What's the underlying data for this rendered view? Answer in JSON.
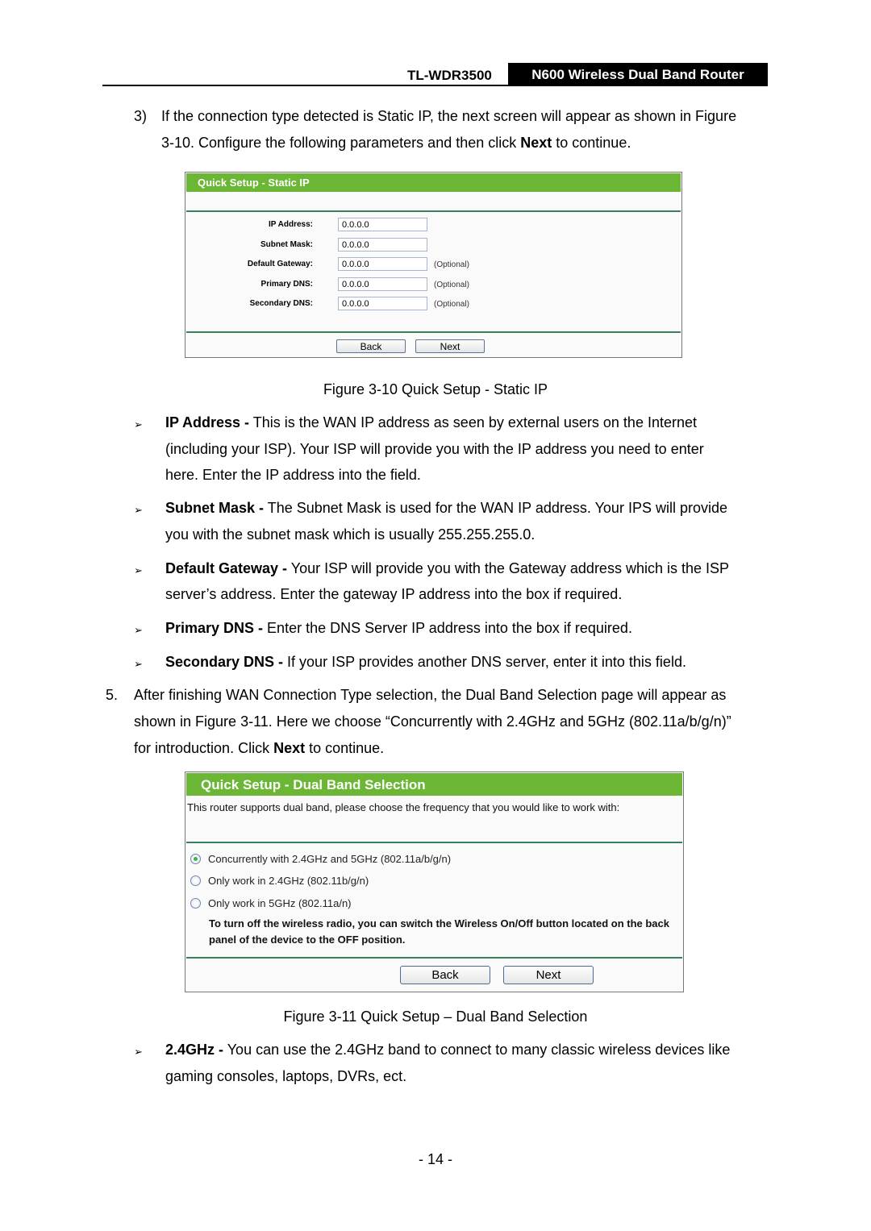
{
  "header": {
    "model": "TL-WDR3500",
    "product": "N600 Wireless Dual Band Router"
  },
  "intro_step3": {
    "number": "3)",
    "text_line1": "If the connection type detected is Static IP, the next screen will appear as shown in Figure",
    "text_line2_prefix": "3-10. Configure the following parameters and then click ",
    "text_line2_bold": "Next",
    "text_line2_suffix": " to continue."
  },
  "figure_static_ip": {
    "title": "Quick Setup - Static IP",
    "fields": [
      {
        "label": "IP Address:",
        "value": "0.0.0.0",
        "note": ""
      },
      {
        "label": "Subnet Mask:",
        "value": "0.0.0.0",
        "note": ""
      },
      {
        "label": "Default Gateway:",
        "value": "0.0.0.0",
        "note": "(Optional)"
      },
      {
        "label": "Primary DNS:",
        "value": "0.0.0.0",
        "note": "(Optional)"
      },
      {
        "label": "Secondary DNS:",
        "value": "0.0.0.0",
        "note": "(Optional)"
      }
    ],
    "back_label": "Back",
    "next_label": "Next",
    "caption": "Figure 3-10 Quick Setup - Static IP"
  },
  "bullets_static": [
    {
      "term": "IP Address -",
      "lines": [
        " This is the WAN IP address as seen by external users on the Internet",
        "(including your ISP). Your ISP will provide you with the IP address you need to enter",
        "here. Enter the IP address into the field."
      ]
    },
    {
      "term": "Subnet Mask -",
      "lines": [
        " The Subnet Mask is used for the WAN IP address. Your IPS will provide",
        "you with the subnet mask which is usually 255.255.255.0."
      ]
    },
    {
      "term": "Default Gateway -",
      "lines": [
        " Your ISP will provide you with the Gateway address which is the ISP",
        "server’s address. Enter the gateway IP address into the box if required."
      ]
    },
    {
      "term": "Primary DNS -",
      "lines": [
        " Enter the DNS Server IP address into the box if required."
      ]
    },
    {
      "term": "Secondary DNS -",
      "lines": [
        " If your ISP provides another DNS server, enter it into this field."
      ]
    }
  ],
  "step5": {
    "number": "5.",
    "line1": "After finishing WAN Connection Type selection, the Dual Band Selection page will appear as",
    "line2": "shown in Figure 3-11. Here we choose “Concurrently with 2.4GHz and 5GHz (802.11a/b/g/n)”",
    "line3_prefix": "for introduction. Click ",
    "line3_bold": "Next",
    "line3_suffix": " to continue."
  },
  "figure_dual_band": {
    "title": "Quick Setup - Dual Band Selection",
    "description": "This router supports dual band, please choose the frequency that you would like to work with:",
    "options": [
      {
        "label": "Concurrently with 2.4GHz and 5GHz (802.11a/b/g/n)",
        "selected": true
      },
      {
        "label": "Only work in 2.4GHz (802.11b/g/n)",
        "selected": false
      },
      {
        "label": "Only work in 5GHz (802.11a/n)",
        "selected": false
      }
    ],
    "note": "To turn off the wireless radio, you can switch the Wireless On/Off button located on the back panel of the device to the OFF position.",
    "back_label": "Back",
    "next_label": "Next",
    "caption": "Figure 3-11 Quick Setup – Dual Band Selection"
  },
  "bullets_band": [
    {
      "term": "2.4GHz -",
      "lines": [
        " You can use the 2.4GHz band to connect to many classic wireless devices like",
        "gaming consoles, laptops, DVRs, ect."
      ]
    }
  ],
  "bullet_glyph": "➢",
  "page_number": "- 14 -",
  "colors": {
    "title_bar": "#6bb634",
    "divider": "#3a7f5b",
    "header_box": "#000000"
  }
}
